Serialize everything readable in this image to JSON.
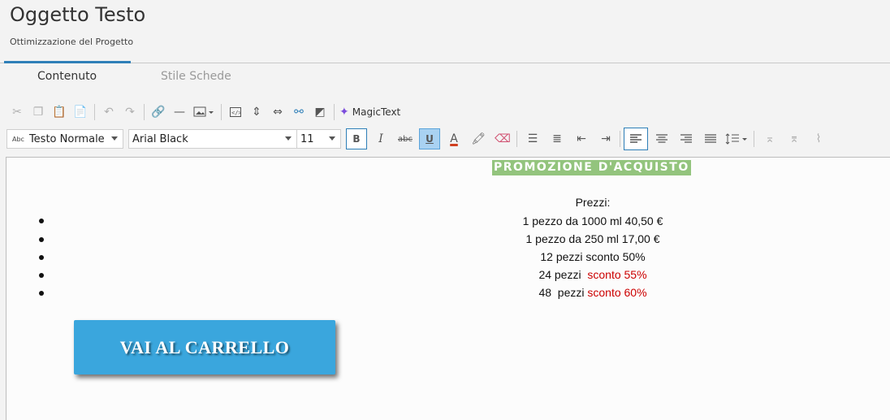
{
  "header": {
    "title": "Oggetto Testo",
    "subtitle": "Ottimizzazione del Progetto"
  },
  "tabs": [
    {
      "label": "Contenuto",
      "active": true
    },
    {
      "label": "Stile Schede",
      "active": false
    }
  ],
  "toolbar": {
    "magic_label": "MagicText",
    "paragraph_style": "Testo Normale",
    "paragraph_style_prefix": "Abc",
    "font_family": "Arial Black",
    "font_size": "11",
    "bold_label": "B",
    "italic_label": "I",
    "strike_label": "abc",
    "underline_label": "U",
    "font_color_label": "A",
    "underline_active": true,
    "align_left_active": true
  },
  "editor": {
    "promo_heading": "PROMOZIONE D'ACQUISTO",
    "prices_label": "Prezzi:",
    "items": [
      {
        "text": "1 pezzo  da 1000 ml 40,50 €",
        "red": ""
      },
      {
        "text": "1 pezzo da 250 ml 17,00 €",
        "red": ""
      },
      {
        "text": "12 pezzi sconto 50%",
        "red": ""
      },
      {
        "text": "24 pezzi  ",
        "red": "sconto 55%"
      },
      {
        "text": "48  pezzi ",
        "red": "sconto 60%"
      }
    ],
    "cta_label": "VAI AL CARRELLO"
  },
  "colors": {
    "accent": "#2e7fb8",
    "promo_bg": "#93c47d",
    "cta_bg": "#3aa6dd",
    "discount_red": "#cc0000"
  }
}
